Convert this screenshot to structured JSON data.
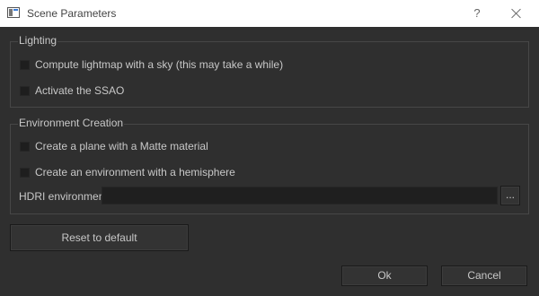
{
  "window": {
    "title": "Scene Parameters",
    "help_label": "?"
  },
  "lighting": {
    "title": "Lighting",
    "options": [
      {
        "label": "Compute lightmap with a sky (this may take a while)",
        "checked": false
      },
      {
        "label": "Activate the SSAO",
        "checked": false
      }
    ]
  },
  "environment": {
    "title": "Environment Creation",
    "options": [
      {
        "label": "Create a plane with a Matte material",
        "checked": false
      },
      {
        "label": "Create an environment with a hemisphere",
        "checked": false
      }
    ],
    "hdri_label": "HDRI environment",
    "hdri_value": "",
    "browse_label": "..."
  },
  "buttons": {
    "reset": "Reset to default",
    "ok": "Ok",
    "cancel": "Cancel"
  }
}
